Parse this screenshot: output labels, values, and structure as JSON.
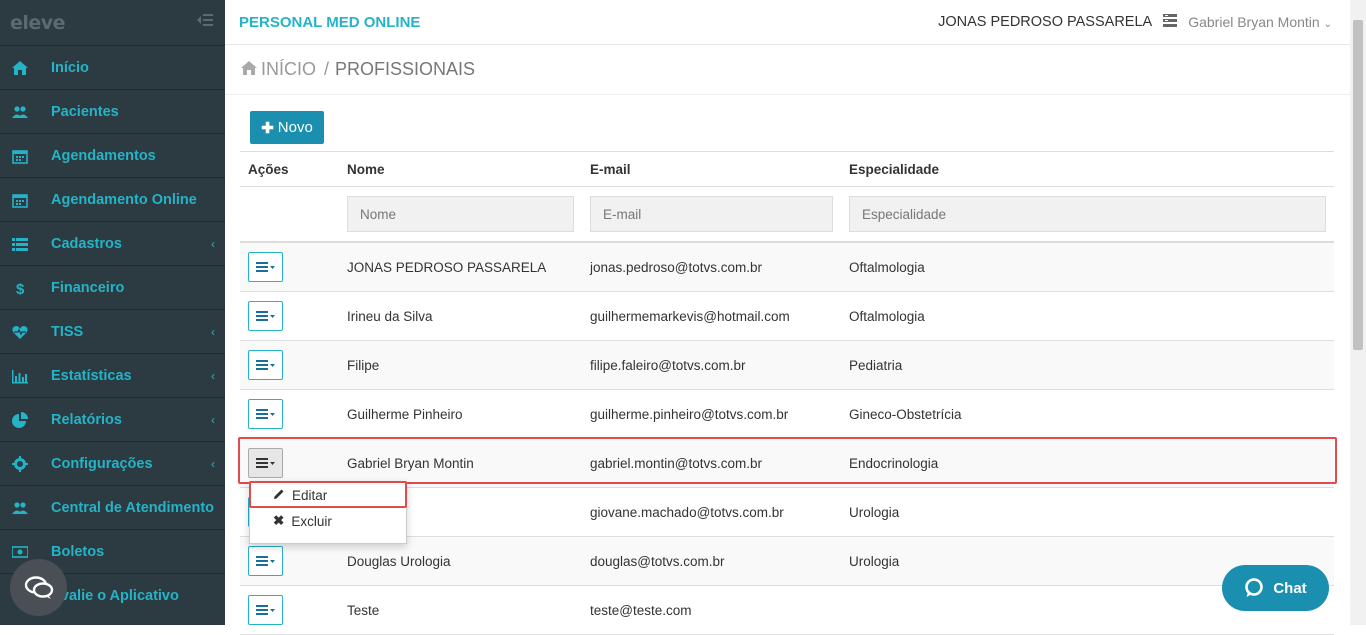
{
  "logo": "eleve",
  "sidebar": {
    "items": [
      {
        "label": "Início",
        "icon": "home-icon",
        "caret": false
      },
      {
        "label": "Pacientes",
        "icon": "users-icon",
        "caret": false
      },
      {
        "label": "Agendamentos",
        "icon": "calendar-icon",
        "caret": false
      },
      {
        "label": "Agendamento Online",
        "icon": "calendar-icon",
        "caret": false
      },
      {
        "label": "Cadastros",
        "icon": "list-icon",
        "caret": true
      },
      {
        "label": "Financeiro",
        "icon": "dollar-icon",
        "caret": false
      },
      {
        "label": "TISS",
        "icon": "heartbeat-icon",
        "caret": true
      },
      {
        "label": "Estatísticas",
        "icon": "bar-chart-icon",
        "caret": true
      },
      {
        "label": "Relatórios",
        "icon": "pie-chart-icon",
        "caret": true
      },
      {
        "label": "Configurações",
        "icon": "gear-icon",
        "caret": true
      },
      {
        "label": "Central de Atendimento",
        "icon": "users-icon",
        "caret": false
      },
      {
        "label": "Boletos",
        "icon": "money-icon",
        "caret": false
      },
      {
        "label": "Avalie o Aplicativo",
        "icon": "star-icon",
        "caret": false
      }
    ]
  },
  "header": {
    "app_title": "PERSONAL MED ONLINE",
    "clinic": "JONAS PEDROSO PASSARELA",
    "user": "Gabriel Bryan Montin"
  },
  "breadcrumb": {
    "home": "INÍCIO",
    "current": "PROFISSIONAIS"
  },
  "new_button": "Novo",
  "table": {
    "headers": {
      "actions": "Ações",
      "name": "Nome",
      "email": "E-mail",
      "specialty": "Especialidade"
    },
    "filters": {
      "name": "Nome",
      "email": "E-mail",
      "specialty": "Especialidade"
    },
    "rows": [
      {
        "name": "JONAS PEDROSO PASSARELA",
        "email": "jonas.pedroso@totvs.com.br",
        "specialty": "Oftalmologia"
      },
      {
        "name": "Irineu da Silva",
        "email": "guilhermemarkevis@hotmail.com",
        "specialty": "Oftalmologia"
      },
      {
        "name": "Filipe",
        "email": "filipe.faleiro@totvs.com.br",
        "specialty": "Pediatria"
      },
      {
        "name": "Guilherme Pinheiro",
        "email": "guilherme.pinheiro@totvs.com.br",
        "specialty": "Gineco-Obstetrícia"
      },
      {
        "name": "Gabriel Bryan Montin",
        "email": "gabriel.montin@totvs.com.br",
        "specialty": "Endocrinologia"
      },
      {
        "name": "",
        "email": "giovane.machado@totvs.com.br",
        "specialty": "Urologia"
      },
      {
        "name": "Douglas Urologia",
        "email": "douglas@totvs.com.br",
        "specialty": "Urologia"
      },
      {
        "name": "Teste",
        "email": "teste@teste.com",
        "specialty": ""
      }
    ]
  },
  "dropdown": {
    "edit": "Editar",
    "delete": "Excluir"
  },
  "chat": {
    "label": "Chat"
  },
  "colors": {
    "sidebar_bg": "#2b3b41",
    "accent": "#25b3c7",
    "button": "#1a8fb0",
    "highlight": "#e04b4b"
  }
}
